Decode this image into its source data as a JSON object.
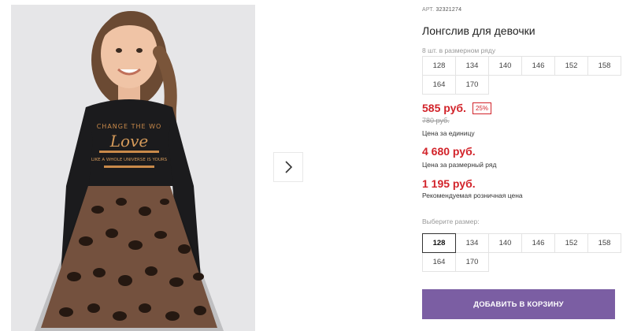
{
  "product": {
    "sku_label": "АРТ.",
    "sku_number": "32321274",
    "title": "Лонгслив для девочки",
    "print_line1": "CHANGE THE WO",
    "print_line2": "Love",
    "print_line3": "LIKE A WHOLE UNIVERSE IS YOURS"
  },
  "pack": {
    "label": "8 шт. в размерном ряду",
    "sizes": [
      "128",
      "134",
      "140",
      "146",
      "152",
      "158",
      "164",
      "170"
    ]
  },
  "prices": {
    "unit_price": "585 руб.",
    "discount": "25%",
    "old_price": "780 руб.",
    "unit_label": "Цена за единицу",
    "pack_price": "4 680 руб.",
    "pack_label": "Цена за размерный ряд",
    "rrp_price": "1 195 руб.",
    "rrp_label": "Рекомендуемая розничная цена"
  },
  "size_select": {
    "label": "Выберите размер:",
    "selected": "128",
    "sizes": [
      "128",
      "134",
      "140",
      "146",
      "152",
      "158",
      "164",
      "170"
    ]
  },
  "actions": {
    "add_to_cart": "ДОБАВИТЬ В КОРЗИНУ"
  },
  "icons": {
    "next": "chevron-right-icon"
  },
  "colors": {
    "price": "#d2232a",
    "button": "#7b5ea3"
  }
}
